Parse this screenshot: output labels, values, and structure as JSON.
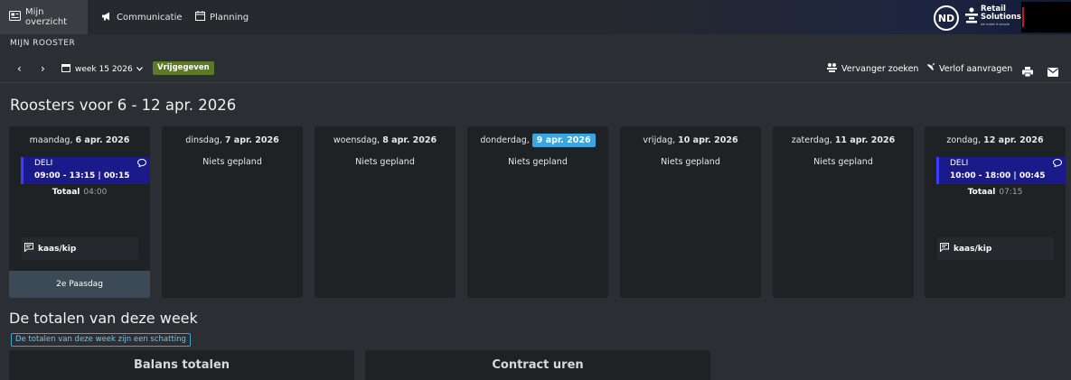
{
  "nav": {
    "tabs": [
      {
        "label": "Mijn overzicht",
        "icon": "dashboard-icon"
      },
      {
        "label": "Communicatie",
        "icon": "megaphone-icon"
      },
      {
        "label": "Planning",
        "icon": "calendar-icon"
      }
    ],
    "avatar": "ND",
    "logo": {
      "line1": "Retail",
      "line2": "Solutions",
      "tagline": "we make it simple"
    }
  },
  "page": {
    "header": "MIJN ROOSTER",
    "week_label": "week 15 2026",
    "status_badge": "Vrijgegeven",
    "actions": {
      "replacement": "Vervanger zoeken",
      "leave": "Verlof aanvragen"
    },
    "title": "Roosters voor 6 - 12 apr. 2026"
  },
  "days": [
    {
      "weekday": "maandag,",
      "date": "6 apr. 2026",
      "shift": {
        "dept": "DELI",
        "time": "09:00 - 13:15 | 00:15"
      },
      "total_label": "Totaal",
      "total": "04:00",
      "note": "kaas/kip",
      "holiday": "2e Paasdag"
    },
    {
      "weekday": "dinsdag,",
      "date": "7 apr. 2026",
      "empty": "Niets gepland"
    },
    {
      "weekday": "woensdag,",
      "date": "8 apr. 2026",
      "empty": "Niets gepland"
    },
    {
      "weekday": "donderdag,",
      "date": "9 apr. 2026",
      "today": true,
      "empty": "Niets gepland"
    },
    {
      "weekday": "vrijdag,",
      "date": "10 apr. 2026",
      "empty": "Niets gepland"
    },
    {
      "weekday": "zaterdag,",
      "date": "11 apr. 2026",
      "empty": "Niets gepland"
    },
    {
      "weekday": "zondag,",
      "date": "12 apr. 2026",
      "shift": {
        "dept": "DELI",
        "time": "10:00 - 18:00 | 00:45"
      },
      "total_label": "Totaal",
      "total": "07:15",
      "note": "kaas/kip"
    }
  ],
  "totals": {
    "title": "De totalen van deze week",
    "estimate_badge": "De totalen van deze week zijn een schatting",
    "cards": [
      "Balans totalen",
      "Contract uren"
    ]
  },
  "colors": {
    "shift": "#1a1a8a",
    "today": "#3aa6e0",
    "badge": "#5a7a28",
    "holiday": "#3b4a56"
  }
}
